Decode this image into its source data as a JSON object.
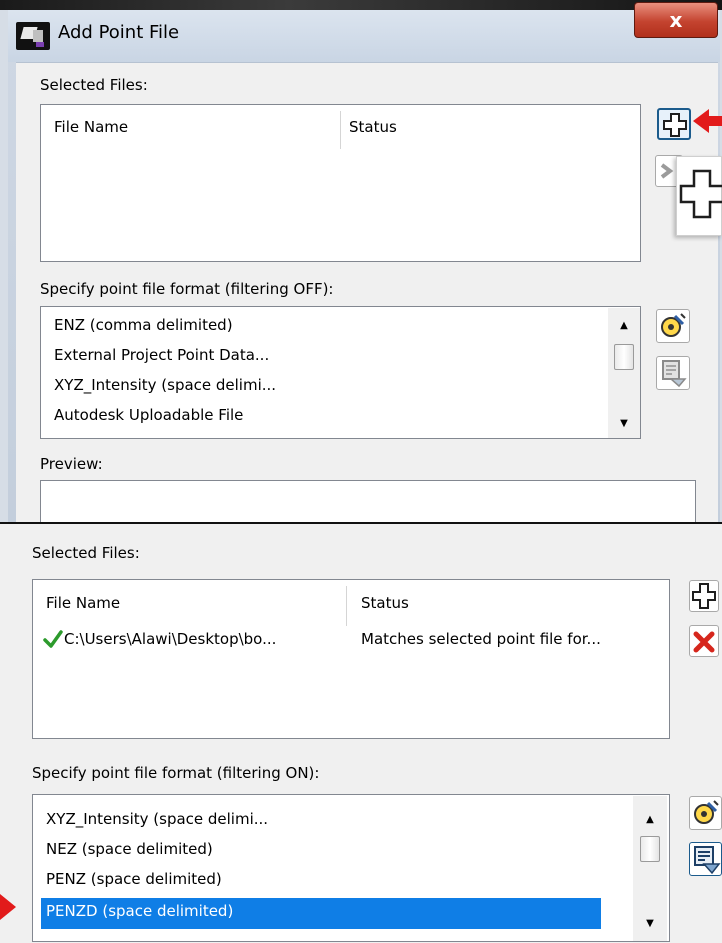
{
  "window": {
    "title": "Add Point File",
    "close_glyph": "x"
  },
  "top": {
    "selected_files_label": "Selected Files:",
    "columns": [
      "File Name",
      "Status"
    ],
    "format_label": "Specify point file format (filtering OFF):",
    "formats": [
      "ENZ (comma delimited)",
      "External Project Point Data...",
      "XYZ_Intensity (space delimi...",
      "Autodesk Uploadable File"
    ],
    "preview_label": "Preview:"
  },
  "bottom": {
    "selected_files_label": "Selected Files:",
    "columns": [
      "File Name",
      "Status"
    ],
    "file_row": {
      "name": "C:\\Users\\Alawi\\Desktop\\bo...",
      "status": "Matches selected point file for..."
    },
    "format_label": "Specify point file format (filtering ON):",
    "formats": [
      "XYZ_Intensity (space delimi...",
      "NEZ (space delimited)",
      "PENZ (space delimited)",
      "PENZD (space delimited)"
    ],
    "selected_format": "PENZD (space delimited)"
  },
  "icons": {
    "add": "add-file-icon",
    "remove": "remove-file-icon",
    "edit_format": "edit-format-icon",
    "filter": "filter-format-icon",
    "check": "check-icon",
    "callout_arrow": "red-arrow-icon"
  },
  "colors": {
    "selection": "#0f7ee6",
    "annotation": "#e21b1b",
    "remove_red": "#d6261c",
    "check_green": "#2c9a2c"
  }
}
